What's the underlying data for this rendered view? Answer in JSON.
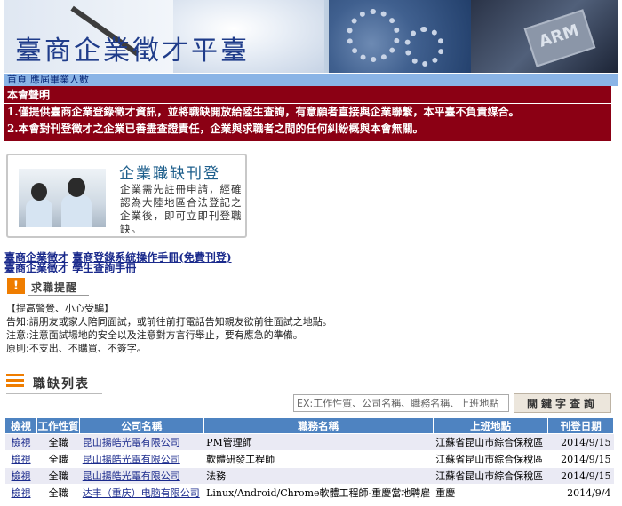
{
  "banner": {
    "title": "臺商企業徵才平臺",
    "chip_text": "ARM"
  },
  "nav": {
    "items": [
      "首頁",
      "應屆畢業人數"
    ]
  },
  "notice": {
    "header": "本會聲明",
    "lines": [
      "1.僅提供臺商企業登錄徵才資訊，並將職缺開放給陸生查詢，有意願者直接與企業聯繫，本平臺不負責媒合。",
      "2.本會對刊登徵才之企業已善盡查證責任，企業與求職者之間的任何糾紛概與本會無關。"
    ]
  },
  "recruit": {
    "title": "企業職缺刊登",
    "description": "企業需先註冊申請，經確認為大陸地區合法登記之企業後，即可立即刊登職缺。"
  },
  "links": {
    "row1": [
      "臺商企業徵才",
      "臺商登錄系統操作手冊(免費刊登)"
    ],
    "row2": [
      "臺商企業徵才",
      "學生查詢手冊"
    ]
  },
  "tips": {
    "title": "求職提醒",
    "lines": [
      "【提高警覺、小心受騙】",
      "告知:請朋友或家人陪同面試，或前往前打電話告知親友欲前往面試之地點。",
      "注意:注意面試場地的安全以及注意對方言行舉止，要有應急的準備。",
      "原則:不支出、不購買、不簽字。"
    ]
  },
  "joblist": {
    "title": "職缺列表",
    "search_placeholder": "EX:工作性質、公司名稱、職務名稱、上班地點",
    "search_button": "關鍵字查詢",
    "columns": [
      "檢視",
      "工作性質",
      "公司名稱",
      "職務名稱",
      "上班地點",
      "刊登日期"
    ],
    "rows": [
      {
        "view": "檢視",
        "type": "全職",
        "company": "昆山揚皓光電有限公司",
        "position": "PM管理師",
        "location": "江蘇省昆山市綜合保稅區",
        "date": "2014/9/15"
      },
      {
        "view": "檢視",
        "type": "全職",
        "company": "昆山揚皓光電有限公司",
        "position": "軟體研發工程師",
        "location": "江蘇省昆山市綜合保稅區",
        "date": "2014/9/15"
      },
      {
        "view": "檢視",
        "type": "全職",
        "company": "昆山揚皓光電有限公司",
        "position": "法務",
        "location": "江蘇省昆山市綜合保稅區",
        "date": "2014/9/15"
      },
      {
        "view": "檢視",
        "type": "全職",
        "company": "达丰（重庆）电脑有限公司",
        "position": "Linux/Android/Chrome軟體工程師-重慶當地聘雇",
        "location": "重慶",
        "date": "2014/9/4"
      }
    ]
  },
  "colors": {
    "nav": "#8ab4e6",
    "notice": "#8b0014",
    "table_header": "#4e83c1",
    "accent": "#ef7d00"
  }
}
